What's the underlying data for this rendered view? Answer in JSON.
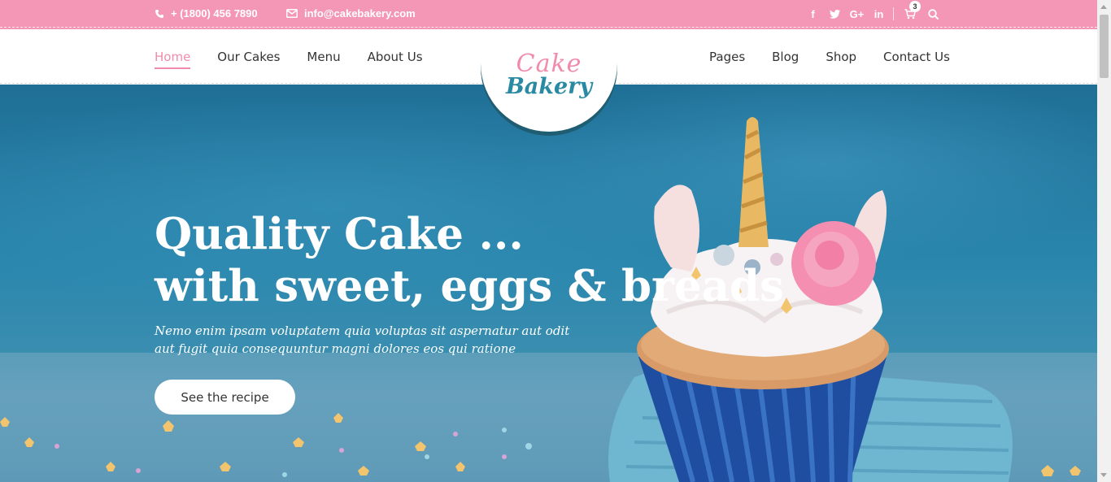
{
  "topbar": {
    "phone": "+ (1800) 456 7890",
    "email": "info@cakebakery.com",
    "socials": [
      {
        "icon": "facebook-icon",
        "glyph": "f"
      },
      {
        "icon": "twitter-icon",
        "glyph": "t"
      },
      {
        "icon": "google-plus-icon",
        "glyph": "G+"
      },
      {
        "icon": "linkedin-icon",
        "glyph": "in"
      }
    ],
    "cart_count": "3"
  },
  "nav": {
    "left": [
      "Home",
      "Our Cakes",
      "Menu",
      "About Us"
    ],
    "right": [
      "Pages",
      "Blog",
      "Shop",
      "Contact Us"
    ],
    "active": "Home"
  },
  "logo": {
    "line1": "Cake",
    "line2": "Bakery"
  },
  "hero": {
    "title_line1": "Quality Cake ...",
    "title_line2": "with sweet, eggs & breads",
    "subtitle": "Nemo enim ipsam voluptatem quia voluptas sit aspernatur aut odit aut fugit quia consequuntur magni dolores eos qui ratione",
    "button_label": "See the recipe"
  },
  "colors": {
    "topbar_pink": "#f497b6",
    "accent_pink": "#f08bab",
    "logo_teal": "#2b8aa3",
    "hero_blue": "#2a86ad"
  }
}
